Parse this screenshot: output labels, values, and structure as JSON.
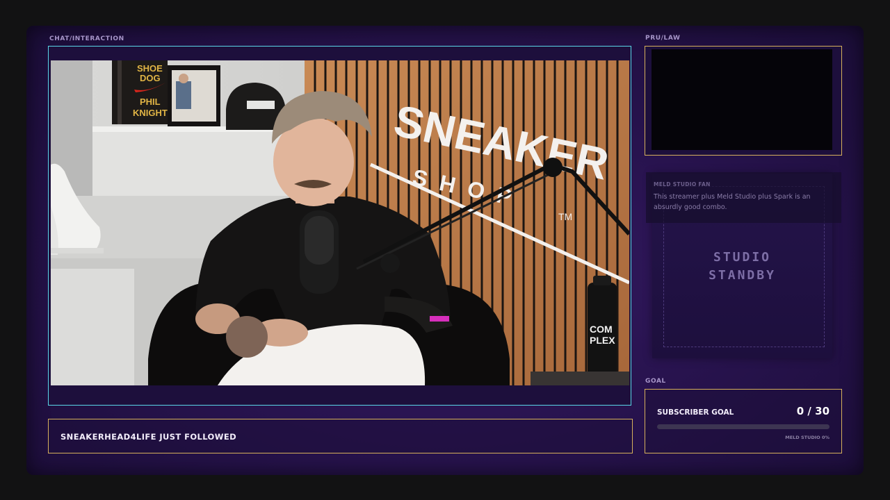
{
  "labels": {
    "chat_interaction": "CHAT/INTERACTION",
    "pru_law": "PRU/LAW",
    "goal": "GOAL"
  },
  "scene": {
    "book_title_line1": "SHOE",
    "book_title_line2": "DOG",
    "book_author_line1": "PHIL",
    "book_author_line2": "KNIGHT",
    "wall_text_1": "SNEAKER",
    "wall_text_2": "SHOP",
    "wall_tm": "TM",
    "bottle_text_1": "COM",
    "bottle_text_2": "PLEX"
  },
  "alert": {
    "text": "SNEAKERHEAD4LIFE JUST FOLLOWED"
  },
  "chat": {
    "username": "MELD STUDIO FAN",
    "message": "This streamer plus Meld Studio plus Spark is an absurdly good combo."
  },
  "standby": {
    "text": "STUDIO\nSTANDBY"
  },
  "goal": {
    "title": "SUBSCRIBER GOAL",
    "count": "0 / 30",
    "progress_fraction": 0,
    "footer": "MELD STUDIO 0%"
  },
  "colors": {
    "frame_purple": "#2a1452",
    "video_border": "#5ad7e8",
    "accent_gold": "#d7b15c"
  }
}
